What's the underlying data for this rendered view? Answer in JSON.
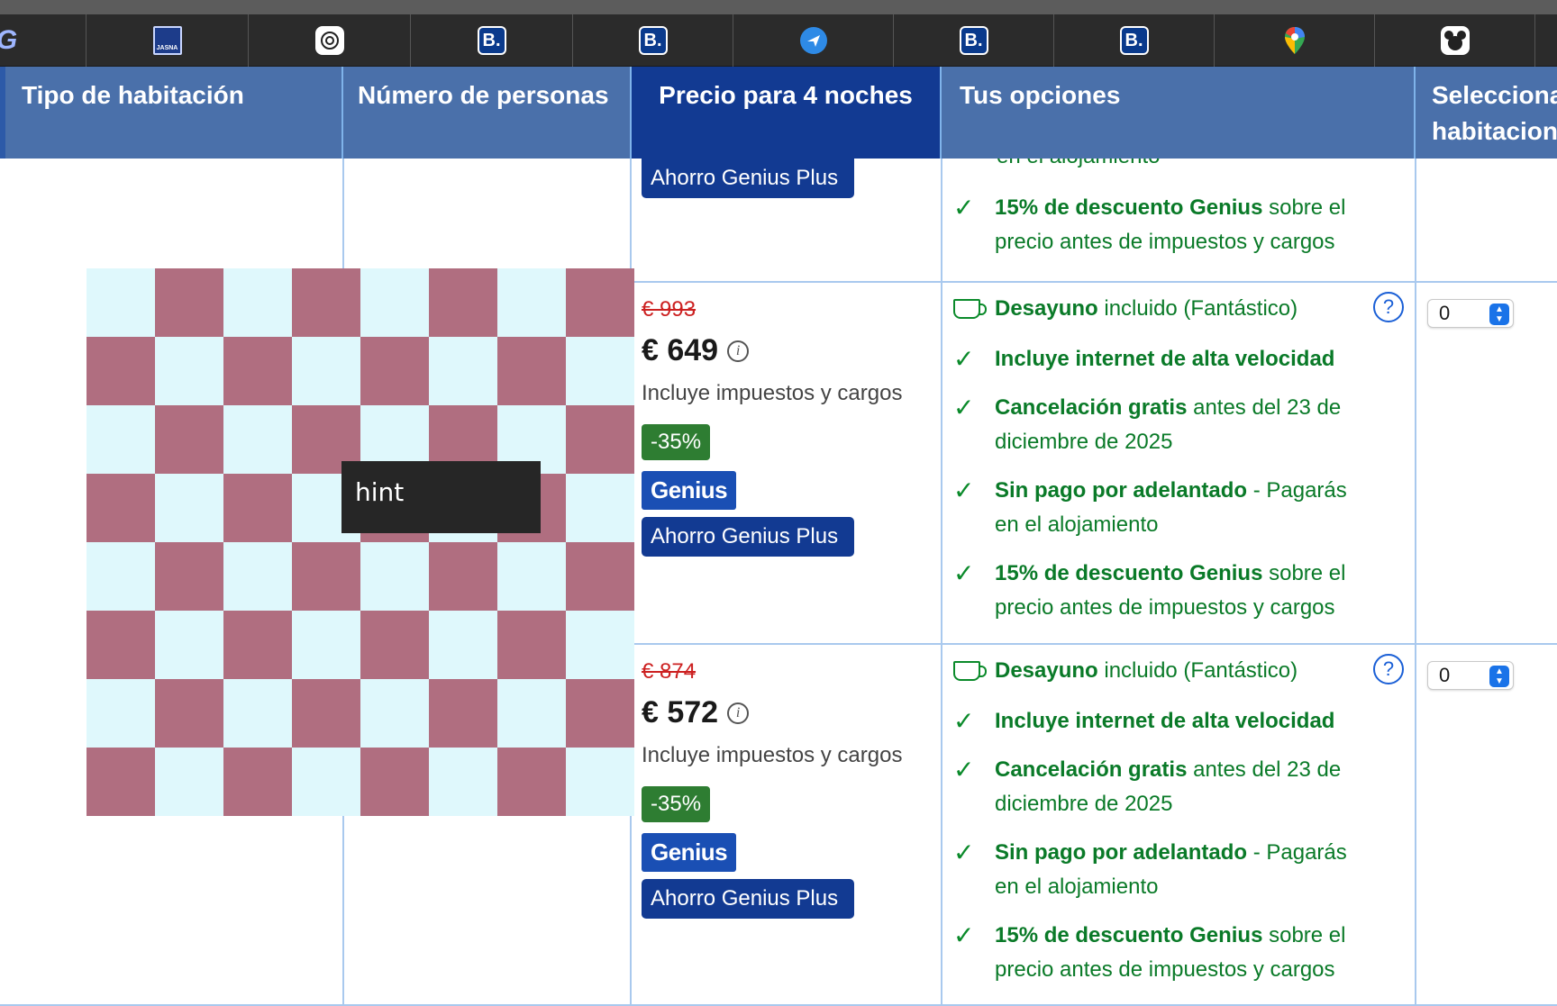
{
  "bookmarks": [
    {
      "name": "g-icon",
      "glyph": "G"
    },
    {
      "name": "jasna-icon",
      "glyph": "JASNA"
    },
    {
      "name": "chatgpt-icon",
      "glyph": "⚙"
    },
    {
      "name": "booking-icon",
      "glyph": "B."
    },
    {
      "name": "booking-icon",
      "glyph": "B."
    },
    {
      "name": "plane-icon",
      "glyph": "✈"
    },
    {
      "name": "booking-icon",
      "glyph": "B."
    },
    {
      "name": "booking-icon",
      "glyph": "B."
    },
    {
      "name": "maps-pin-icon",
      "glyph": ""
    },
    {
      "name": "mouse-ears-icon",
      "glyph": ""
    }
  ],
  "table": {
    "headers": {
      "room_type": "Tipo de habitación",
      "persons": "Número de personas",
      "price": "Precio para 4 noches",
      "options": "Tus opciones",
      "select": "Selecciona habitaciones"
    },
    "top_row": {
      "plus_badge": "Ahorro Genius Plus",
      "partial_text": "en el alojamiento",
      "discount_bold": "15% de descuento Genius",
      "discount_rest": " sobre el precio antes de impuestos y cargos"
    },
    "rows": [
      {
        "old_price": "€ 993",
        "price": "€ 649",
        "tax_note": "Incluye impuestos y cargos",
        "discount_badge": "-35%",
        "genius_label": "Genius",
        "plus_badge": "Ahorro Genius Plus",
        "breakfast_bold": "Desayuno",
        "breakfast_rest": " incluido (Fantástico)",
        "internet": "Incluye internet de alta velocidad",
        "cancel_bold": "Cancelación gratis",
        "cancel_rest": " antes del 23 de diciembre de 2025",
        "nopay_bold": "Sin pago por adelantado",
        "nopay_rest": " - Pagarás en el alojamiento",
        "discount_bold": "15% de descuento Genius",
        "discount_rest": " sobre el precio antes de impuestos y cargos",
        "qty": "0"
      },
      {
        "old_price": "€ 874",
        "price": "€ 572",
        "tax_note": "Incluye impuestos y cargos",
        "discount_badge": "-35%",
        "genius_label": "Genius",
        "plus_badge": "Ahorro Genius Plus",
        "breakfast_bold": "Desayuno",
        "breakfast_rest": " incluido (Fantástico)",
        "internet": "Incluye internet de alta velocidad",
        "cancel_bold": "Cancelación gratis",
        "cancel_rest": " antes del 23 de diciembre de 2025",
        "nopay_bold": "Sin pago por adelantado",
        "nopay_rest": " - Pagarás en el alojamiento",
        "discount_bold": "15% de descuento Genius",
        "discount_rest": " sobre el precio antes de impuestos y cargos",
        "qty": "0"
      }
    ]
  },
  "overlay": {
    "hint_text": "hint",
    "checker_colors": [
      "#dff8fc",
      "#b06e80"
    ]
  },
  "icons": {
    "info": "i",
    "help": "?",
    "check": "✓"
  }
}
